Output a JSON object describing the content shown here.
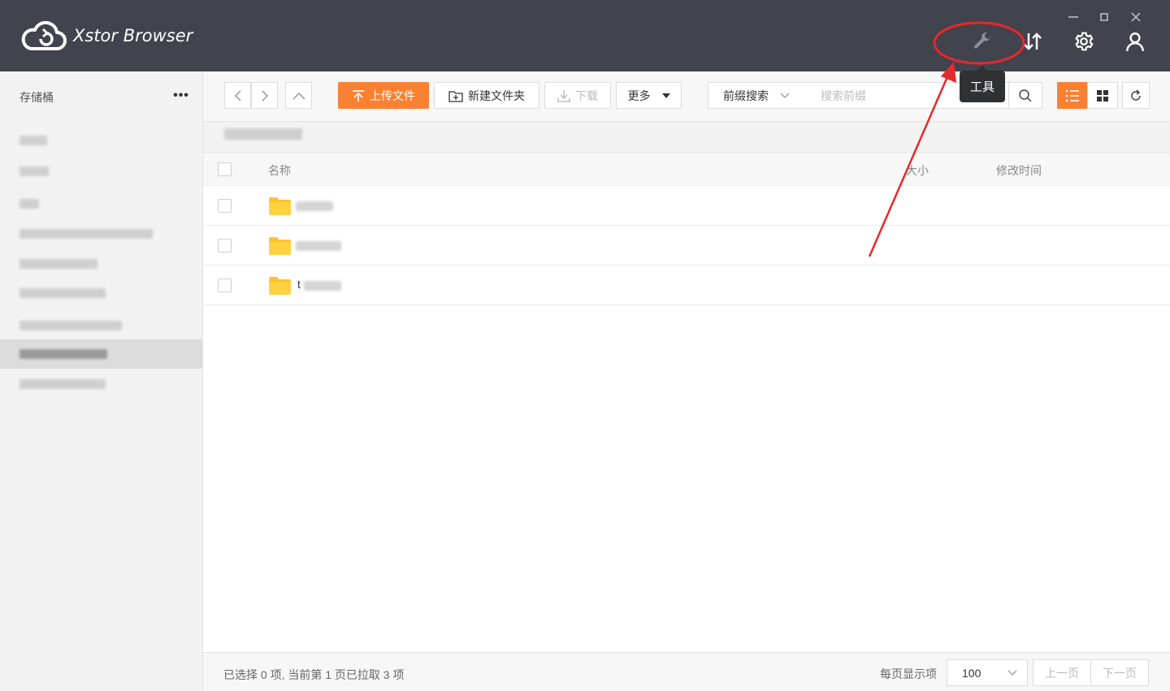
{
  "app": {
    "title": "Xstor Browser"
  },
  "header": {
    "tooltip": "工具",
    "icons": [
      "wrench-icon",
      "transfer-icon",
      "gear-icon",
      "user-icon"
    ]
  },
  "sidebar": {
    "title": "存储桶",
    "more": "•••",
    "buckets": [
      {
        "active": false
      },
      {
        "active": false
      },
      {
        "active": false
      },
      {
        "active": false
      },
      {
        "active": false
      },
      {
        "active": false
      },
      {
        "active": false
      },
      {
        "active": true
      },
      {
        "active": false
      }
    ]
  },
  "toolbar": {
    "upload": "上传文件",
    "new_folder": "新建文件夹",
    "download": "下载",
    "more": "更多",
    "search_type": "前缀搜索",
    "search_placeholder": "搜索前缀"
  },
  "table": {
    "headers": {
      "name": "名称",
      "size": "大小",
      "modified": "修改时间"
    },
    "rows": [
      {
        "name": "",
        "type": "folder"
      },
      {
        "name": "",
        "type": "folder"
      },
      {
        "name": "t",
        "type": "folder"
      }
    ]
  },
  "footer": {
    "status": "已选择 0 项, 当前第 1 页已拉取 3 项",
    "per_page_label": "每页显示项",
    "per_page": "100",
    "prev": "上一页",
    "next": "下一页"
  },
  "colors": {
    "accent": "#fb8132",
    "titlebar": "#41434d",
    "annotation": "#e8282b"
  }
}
